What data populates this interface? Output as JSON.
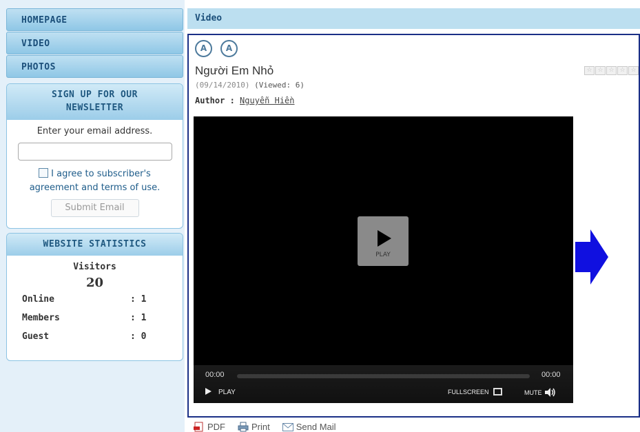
{
  "sidebar": {
    "nav": [
      {
        "label": "HOMEPAGE"
      },
      {
        "label": "VIDEO"
      },
      {
        "label": "PHOTOS"
      }
    ],
    "newsletter": {
      "title_line1": "SIGN UP FOR OUR",
      "title_line2": "NEWSLETTER",
      "prompt": "Enter your email address.",
      "email_value": "",
      "agree_line1": "I agree to subscriber's",
      "agree_line2": "agreement and terms of use.",
      "submit_label": "Submit Email"
    },
    "stats": {
      "title": "WEBSITE STATISTICS",
      "visitors_label": "Visitors",
      "visitors_total": "20",
      "rows": [
        {
          "label": "Online",
          "value": ": 1"
        },
        {
          "label": "Members",
          "value": ": 1"
        },
        {
          "label": "Guest",
          "value": ": 0"
        }
      ]
    }
  },
  "main": {
    "header": "Video",
    "font_buttons": [
      "A",
      "A"
    ],
    "title": "Người Em Nhỏ",
    "date": "(09/14/2010)",
    "viewed": "(Viewed: 6)",
    "author_label": "Author :",
    "author_name": "Nguyễn Hiền",
    "rating_stars": 5,
    "player": {
      "play_label": "PLAY",
      "time_current": "00:00",
      "time_total": "00:00",
      "ctrl_play": "PLAY",
      "fullscreen": "FULLSCREEN",
      "mute": "MUTE"
    },
    "arrow_color": "#1010e0"
  },
  "footer_links": {
    "pdf": "PDF",
    "print": "Print",
    "send_mail": "Send Mail"
  }
}
